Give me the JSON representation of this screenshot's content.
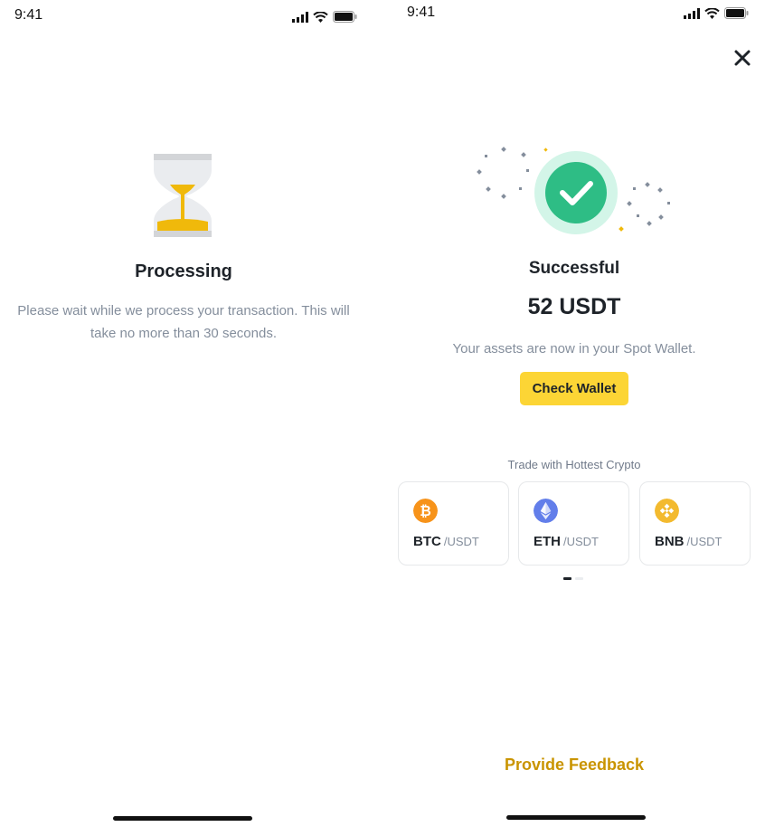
{
  "processing_screen": {
    "status_time": "9:41",
    "title": "Processing",
    "message": "Please wait while we process your transaction. This will take no more than 30 seconds."
  },
  "success_screen": {
    "status_time": "9:41",
    "title": "Successful",
    "amount": "52 USDT",
    "message": "Your assets are now in your Spot Wallet.",
    "check_wallet_label": "Check Wallet",
    "trade_heading": "Trade with Hottest Crypto",
    "pairs": [
      {
        "base": "BTC",
        "quote": "/USDT",
        "icon": "bitcoin-icon",
        "color": "#f7931a"
      },
      {
        "base": "ETH",
        "quote": "/USDT",
        "icon": "ethereum-icon",
        "color": "#627eea"
      },
      {
        "base": "BNB",
        "quote": "/USDT",
        "icon": "bnb-icon",
        "color": "#f3ba2f"
      }
    ],
    "feedback_label": "Provide Feedback"
  },
  "colors": {
    "brand_yellow": "#fcd535",
    "success_green": "#2ebd85",
    "feedback_gold": "#c99400",
    "muted_text": "#848e9c"
  }
}
